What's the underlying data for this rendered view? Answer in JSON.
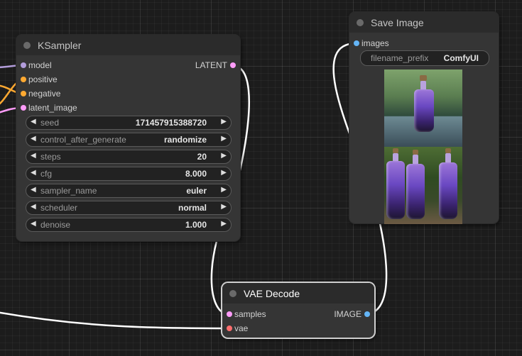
{
  "colors": {
    "canvas_bg": "#1c1c1c",
    "node_bg": "#353535",
    "node_header": "#2b2b2b",
    "model_pin": "#b39ddb",
    "conditioning_pin": "#ffa931",
    "latent_pin": "#ff9cf9",
    "image_pin": "#64b5f6",
    "vae_pin": "#ff6e6e",
    "wire": "#ffffff"
  },
  "ksampler": {
    "title": "KSampler",
    "inputs": [
      "model",
      "positive",
      "negative",
      "latent_image"
    ],
    "output": "LATENT",
    "widgets": [
      {
        "name": "seed",
        "value": "171457915388720"
      },
      {
        "name": "control_after_generate",
        "value": "randomize"
      },
      {
        "name": "steps",
        "value": "20"
      },
      {
        "name": "cfg",
        "value": "8.000"
      },
      {
        "name": "sampler_name",
        "value": "euler"
      },
      {
        "name": "scheduler",
        "value": "normal"
      },
      {
        "name": "denoise",
        "value": "1.000"
      }
    ],
    "left_arrow_icon": "◀",
    "right_arrow_icon": "▶"
  },
  "save_image": {
    "title": "Save Image",
    "input": "images",
    "filename_prefix_label": "filename_prefix",
    "filename_prefix_value": "ComfyUI",
    "preview_icon": "image-preview-purple-bottles"
  },
  "vae_decode": {
    "title": "VAE Decode",
    "inputs": [
      "samples",
      "vae"
    ],
    "output": "IMAGE"
  }
}
